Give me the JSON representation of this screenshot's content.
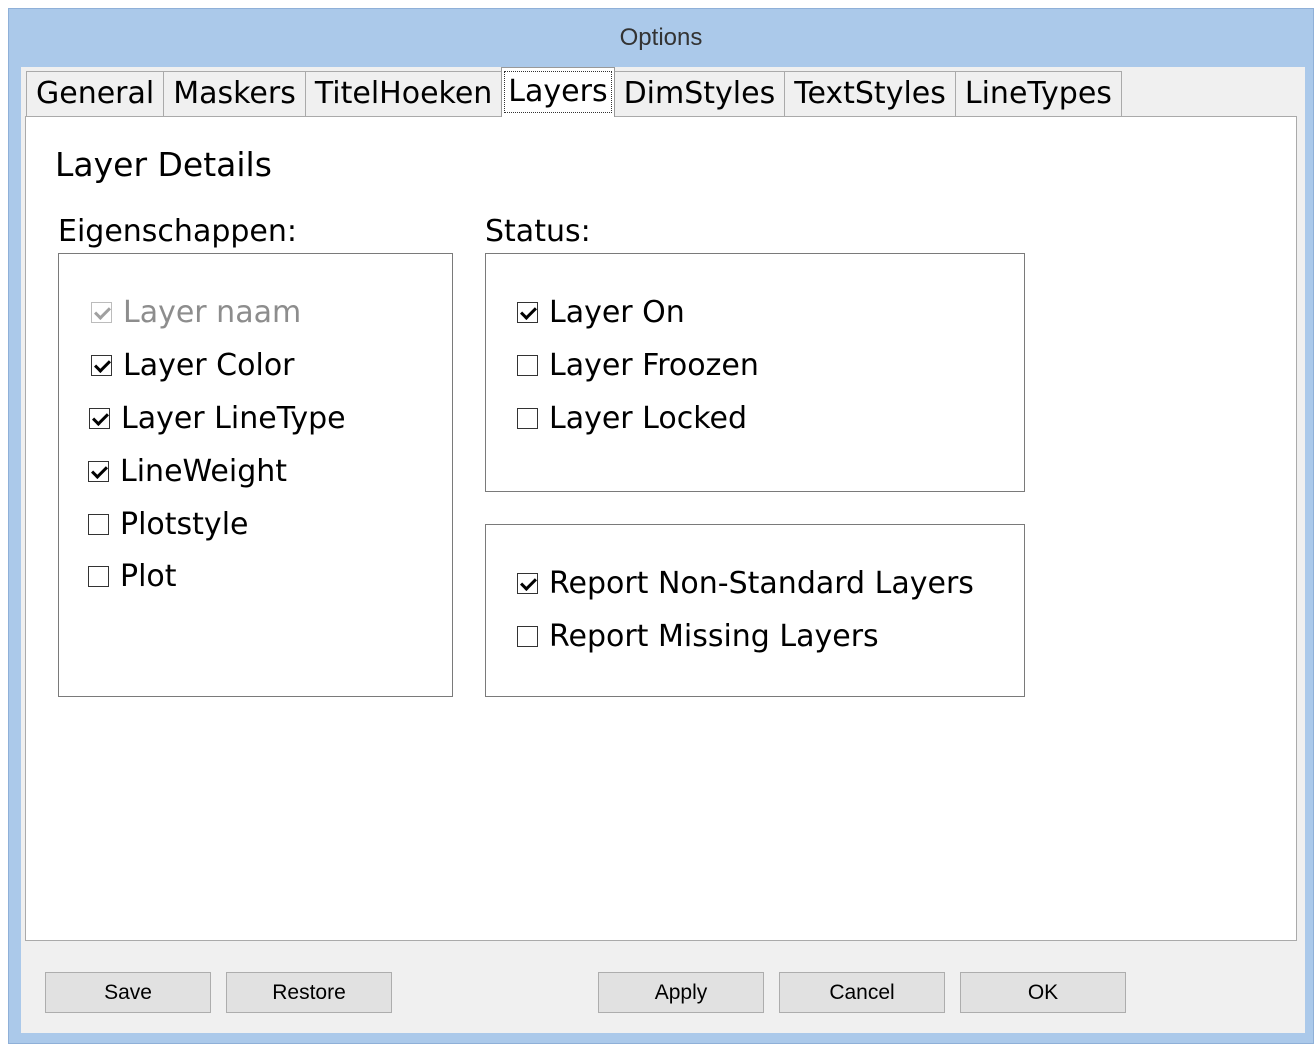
{
  "window": {
    "title": "Options"
  },
  "tabs": [
    {
      "label": "General"
    },
    {
      "label": "Maskers"
    },
    {
      "label": "TitelHoeken"
    },
    {
      "label": "Layers"
    },
    {
      "label": "DimStyles"
    },
    {
      "label": "TextStyles"
    },
    {
      "label": "LineTypes"
    }
  ],
  "page": {
    "heading": "Layer Details",
    "properties": {
      "label": "Eigenschappen:",
      "items": [
        {
          "label": "Layer naam",
          "checked": true,
          "enabled": false
        },
        {
          "label": "Layer Color",
          "checked": true,
          "enabled": true
        },
        {
          "label": "Layer LineType",
          "checked": true,
          "enabled": true
        },
        {
          "label": "LineWeight",
          "checked": true,
          "enabled": true
        },
        {
          "label": "Plotstyle",
          "checked": false,
          "enabled": true
        },
        {
          "label": "Plot",
          "checked": false,
          "enabled": true
        }
      ]
    },
    "status": {
      "label": "Status:",
      "items": [
        {
          "label": "Layer On",
          "checked": true
        },
        {
          "label": "Layer Froozen",
          "checked": false
        },
        {
          "label": "Layer Locked",
          "checked": false
        }
      ]
    },
    "report": {
      "items": [
        {
          "label": "Report Non-Standard Layers",
          "checked": true
        },
        {
          "label": "Report Missing Layers",
          "checked": false
        }
      ]
    }
  },
  "buttons": {
    "save": "Save",
    "restore": "Restore",
    "apply": "Apply",
    "cancel": "Cancel",
    "ok": "OK"
  }
}
